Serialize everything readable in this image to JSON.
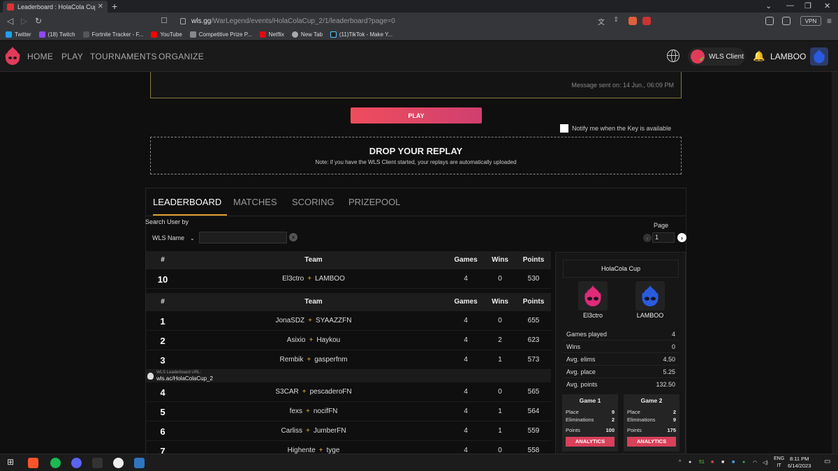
{
  "browser": {
    "tab_title": "Leaderboard : HolaCola Cup - War",
    "url_host": "wls.gg",
    "url_path": "/WarLegend/events/HolaColaCup_2/1/leaderboard?page=0",
    "vpn_label": "VPN",
    "bookmarks": [
      "Twitter",
      "(18) Twitch",
      "Fortnite Tracker - F...",
      "YouTube",
      "Competitive Prize P...",
      "Netflix",
      "New Tab",
      "(11)TikTok - Make Y..."
    ]
  },
  "header": {
    "nav": [
      "HOME",
      "PLAY",
      "TOURNAMENTS",
      "ORGANIZE"
    ],
    "client_label": "WLS Client",
    "username": "LAMBOO"
  },
  "message": {
    "sent_on": "Message sent on: 14 Jun., 06:09 PM"
  },
  "play_label": "PLAY",
  "notify_label": "Notify me when the Key is available",
  "replay": {
    "heading": "DROP YOUR REPLAY",
    "note": "Note: if you have the WLS Client started, your replays are automatically uploaded"
  },
  "tabs": [
    "LEADERBOARD",
    "MATCHES",
    "SCORING",
    "PRIZEPOOL"
  ],
  "search": {
    "label": "Search User by",
    "select_value": "WLS Name"
  },
  "pager": {
    "label": "Page",
    "value": "1"
  },
  "table_headers": {
    "rank": "#",
    "team": "Team",
    "games": "Games",
    "wins": "Wins",
    "points": "Points"
  },
  "my_row": {
    "rank": "10",
    "p1": "El3ctro",
    "p2": "LAMBOO",
    "games": "4",
    "wins": "0",
    "points": "530"
  },
  "rows": [
    {
      "rank": "1",
      "p1": "JonaSDZ",
      "p2": "SYAAZZFN",
      "games": "4",
      "wins": "0",
      "points": "655"
    },
    {
      "rank": "2",
      "p1": "Asixio",
      "p2": "Haykou",
      "games": "4",
      "wins": "2",
      "points": "623"
    },
    {
      "rank": "3",
      "p1": "Rembik",
      "p2": "gasperfnm",
      "games": "4",
      "wins": "1",
      "points": "573"
    },
    {
      "rank": "4",
      "p1": "S3CAR",
      "p2": "pescaderoFN",
      "games": "4",
      "wins": "0",
      "points": "565"
    },
    {
      "rank": "5",
      "p1": "fexs",
      "p2": "nocifFN",
      "games": "4",
      "wins": "1",
      "points": "564"
    },
    {
      "rank": "6",
      "p1": "Carliss",
      "p2": "JumberFN",
      "games": "4",
      "wins": "1",
      "points": "559"
    },
    {
      "rank": "7",
      "p1": "Highente",
      "p2": "tyge",
      "games": "4",
      "wins": "0",
      "points": "558"
    }
  ],
  "wls_url": {
    "label": "WLS Leaderboard URL:",
    "value": "wls.ac/HolaColaCup_2"
  },
  "side": {
    "title": "HolaCola Cup",
    "player1": "El3ctro",
    "player2": "LAMBOO",
    "stats": [
      {
        "k": "Games played",
        "v": "4"
      },
      {
        "k": "Wins",
        "v": "0"
      },
      {
        "k": "Avg. elims",
        "v": "4.50"
      },
      {
        "k": "Avg. place",
        "v": "5.25"
      },
      {
        "k": "Avg. points",
        "v": "132.50"
      }
    ],
    "games": [
      {
        "title": "Game 1",
        "place": "9",
        "elims": "2",
        "points": "100"
      },
      {
        "title": "Game 2",
        "place": "2",
        "elims": "9",
        "points": "175"
      }
    ],
    "labels": {
      "place": "Place",
      "elims": "Eliminations",
      "points": "Points",
      "analytics": "ANALYTICS"
    }
  },
  "taskbar": {
    "lang1": "ENG",
    "lang2": "IT",
    "time": "8:11 PM",
    "date": "6/14/2023",
    "badge": "51"
  },
  "colors": {
    "accent": "#e6b030",
    "play": "#ef4d5d",
    "analytics": "#d9405a",
    "pink_logo": "#e02a7a",
    "blue_logo": "#2a5adf"
  }
}
